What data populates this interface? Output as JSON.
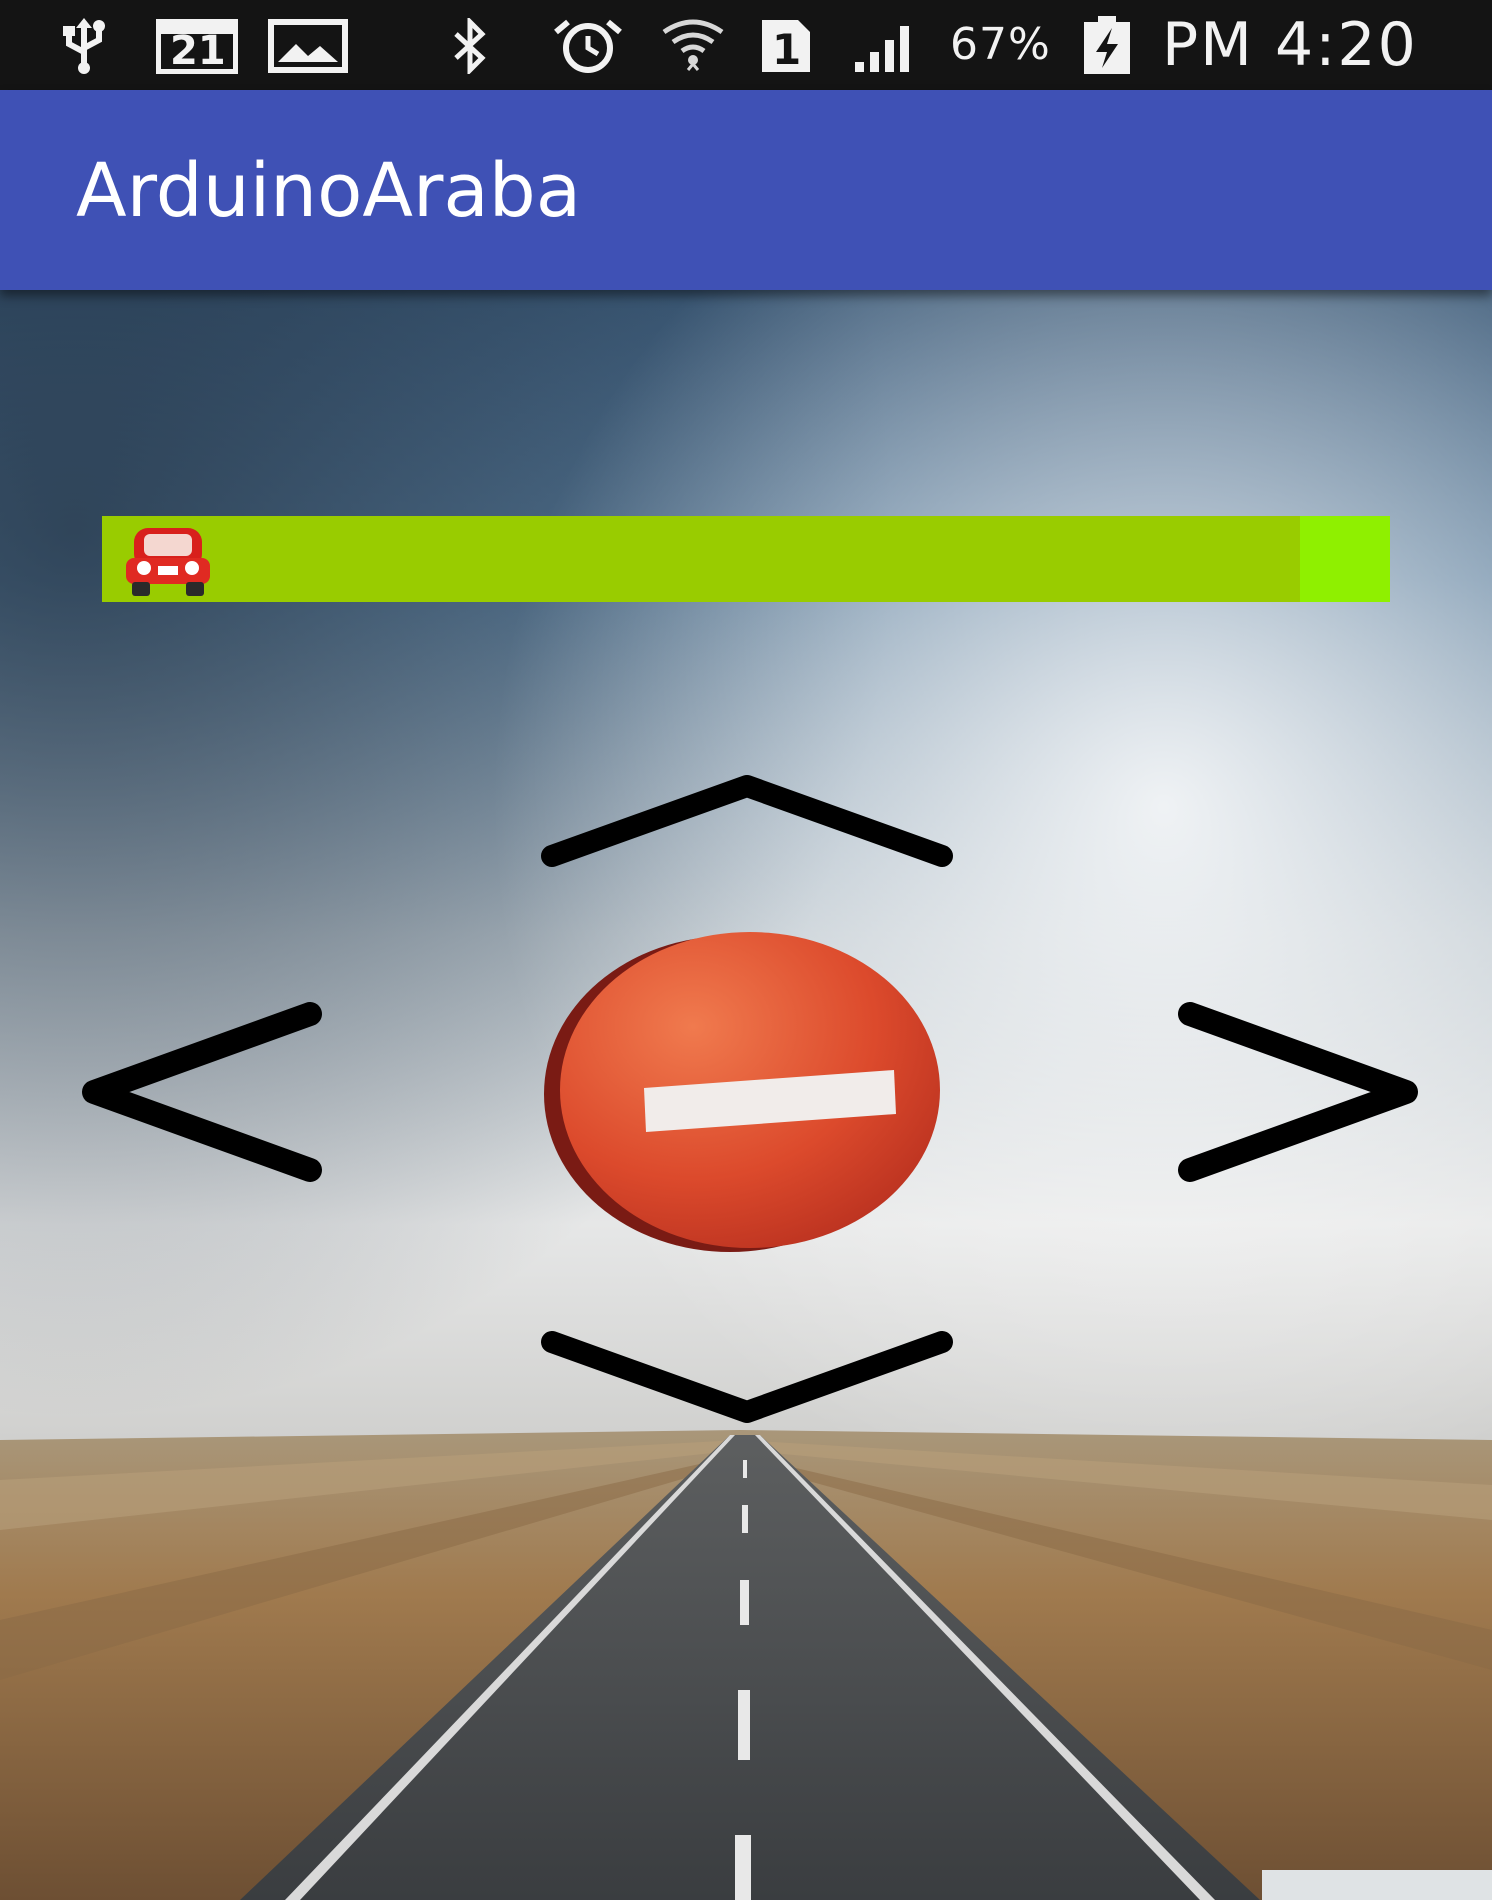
{
  "status_bar": {
    "icons": [
      "usb-icon",
      "calendar-icon",
      "gallery-icon",
      "bluetooth-icon",
      "alarm-icon",
      "wifi-icon",
      "sim-icon",
      "signal-icon",
      "battery-charging-icon"
    ],
    "calendar_day": "21",
    "sim_number": "1",
    "battery_percent": "67%",
    "clock": "PM 4:20"
  },
  "action_bar": {
    "title": "ArduinoAraba",
    "color": "#3f51b5"
  },
  "speed_seekbar": {
    "value_fraction": 0.93,
    "track_color": "#99cc00",
    "remainder_color": "#8ff000",
    "thumb_icon": "red-car-icon"
  },
  "controls": {
    "forward_icon": "chevron-up-icon",
    "backward_icon": "chevron-down-icon",
    "left_icon": "chevron-left-icon",
    "right_icon": "chevron-right-icon",
    "stop_icon": "stop-sign-icon"
  },
  "background": {
    "image": "highway-road-fog-icon"
  }
}
